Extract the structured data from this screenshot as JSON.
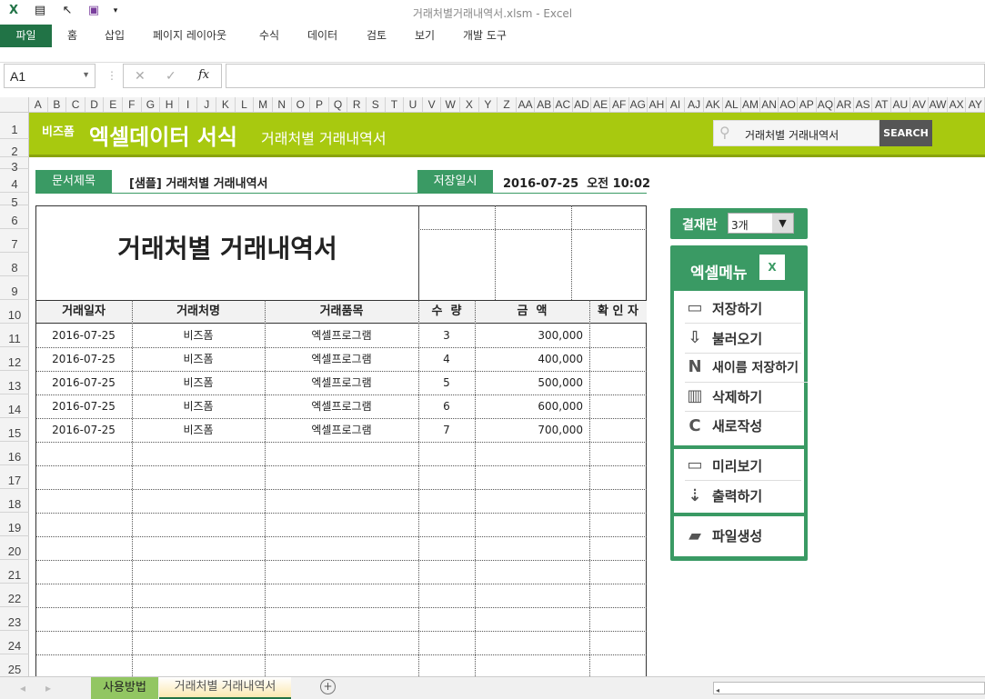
{
  "window": {
    "title": "거래처별거래내역서.xlsm - Excel"
  },
  "ribbon": {
    "tabs": [
      "파일",
      "홈",
      "삽입",
      "페이지 레이아웃",
      "수식",
      "데이터",
      "검토",
      "보기",
      "개발 도구"
    ]
  },
  "formula_bar": {
    "name_box": "A1",
    "cancel": "✕",
    "enter": "✓",
    "fx": "fx",
    "value": ""
  },
  "columns": [
    "A",
    "B",
    "C",
    "D",
    "E",
    "F",
    "G",
    "H",
    "I",
    "J",
    "K",
    "L",
    "M",
    "N",
    "O",
    "P",
    "Q",
    "R",
    "S",
    "T",
    "U",
    "V",
    "W",
    "X",
    "Y",
    "Z",
    "AA",
    "AB",
    "AC",
    "AD",
    "AE",
    "AF",
    "AG",
    "AH",
    "AI",
    "AJ",
    "AK",
    "AL",
    "AM",
    "AN",
    "AO",
    "AP",
    "AQ",
    "AR",
    "AS",
    "AT",
    "AU",
    "AV",
    "AW",
    "AX",
    "AY"
  ],
  "rows": [
    "1",
    "2",
    "3",
    "4",
    "5",
    "6",
    "7",
    "8",
    "9",
    "10",
    "11",
    "12",
    "13",
    "14",
    "15",
    "16",
    "17",
    "18",
    "19",
    "20",
    "21",
    "22",
    "23",
    "24",
    "25"
  ],
  "banner": {
    "brand_small": "비즈폼",
    "brand": "엑셀데이터 서식",
    "subtitle": "거래처별 거래내역서",
    "search_value": "거래처별 거래내역서",
    "search_button": "SEARCH"
  },
  "info": {
    "doc_title_label": "문서제목",
    "doc_title": "[샘플] 거래처별 거래내역서",
    "saved_label": "저장일시",
    "saved_value": "2016-07-25  오전 10:02"
  },
  "sheet": {
    "title": "거래처별 거래내역서",
    "headers": [
      "거래일자",
      "거래처명",
      "거래품목",
      "수  량",
      "금  액",
      "확 인 자"
    ],
    "records": [
      [
        "2016-07-25",
        "비즈폼",
        "엑셀프로그램",
        "3",
        "300,000",
        ""
      ],
      [
        "2016-07-25",
        "비즈폼",
        "엑셀프로그램",
        "4",
        "400,000",
        ""
      ],
      [
        "2016-07-25",
        "비즈폼",
        "엑셀프로그램",
        "5",
        "500,000",
        ""
      ],
      [
        "2016-07-25",
        "비즈폼",
        "엑셀프로그램",
        "6",
        "600,000",
        ""
      ],
      [
        "2016-07-25",
        "비즈폼",
        "엑셀프로그램",
        "7",
        "700,000",
        ""
      ]
    ]
  },
  "approval": {
    "label": "결재란",
    "selected": "3개"
  },
  "menu": {
    "title": "엑셀메뉴",
    "items": [
      "저장하기",
      "불러오기",
      "새이름 저장하기",
      "삭제하기",
      "새로작성",
      "미리보기",
      "출력하기",
      "파일생성"
    ]
  },
  "sheet_tabs": [
    "사용방법",
    "거래처별 거래내역서"
  ],
  "colors": {
    "excel_green": "#217346",
    "banner": "#a8c90f",
    "label_green": "#3a9a64"
  }
}
